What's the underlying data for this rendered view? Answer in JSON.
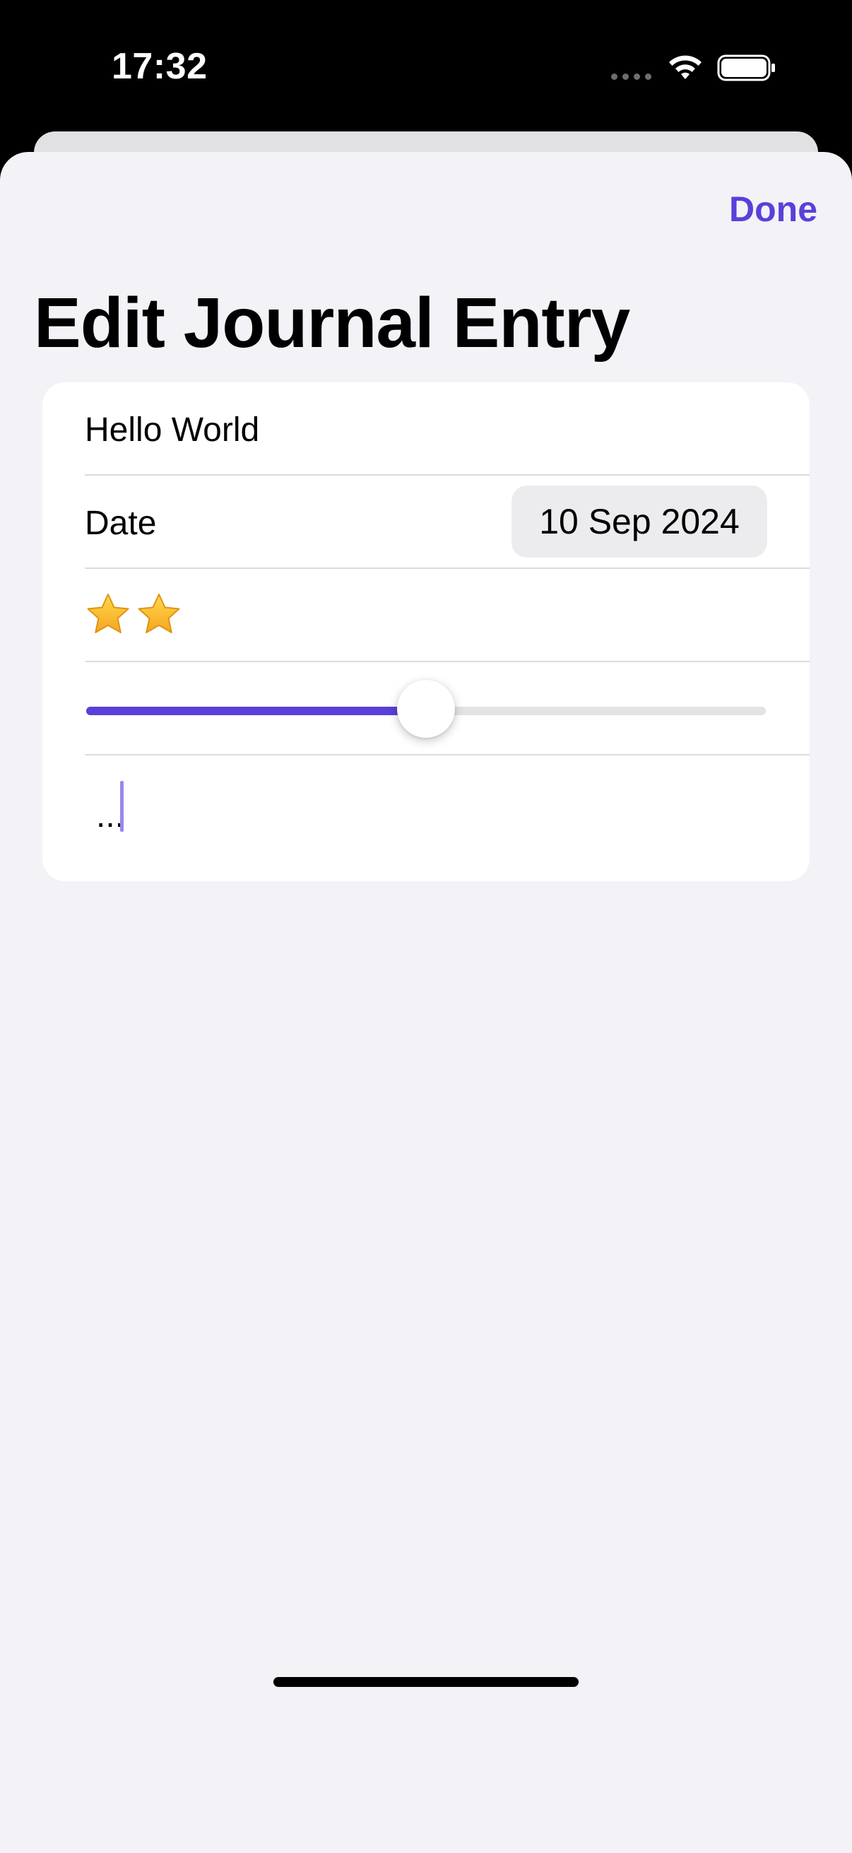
{
  "status_bar": {
    "time": "17:32"
  },
  "sheet": {
    "done_label": "Done",
    "title": "Edit Journal Entry"
  },
  "form": {
    "title_value": "Hello World",
    "date_label": "Date",
    "date_value": "10 Sep 2024",
    "rating": {
      "stars": 2,
      "star_icon": "star-icon"
    },
    "slider": {
      "value": 0.5
    },
    "notes_value": "..."
  },
  "colors": {
    "accent": "#5b3fd9",
    "background": "#f2f2f7",
    "card": "#ffffff"
  }
}
